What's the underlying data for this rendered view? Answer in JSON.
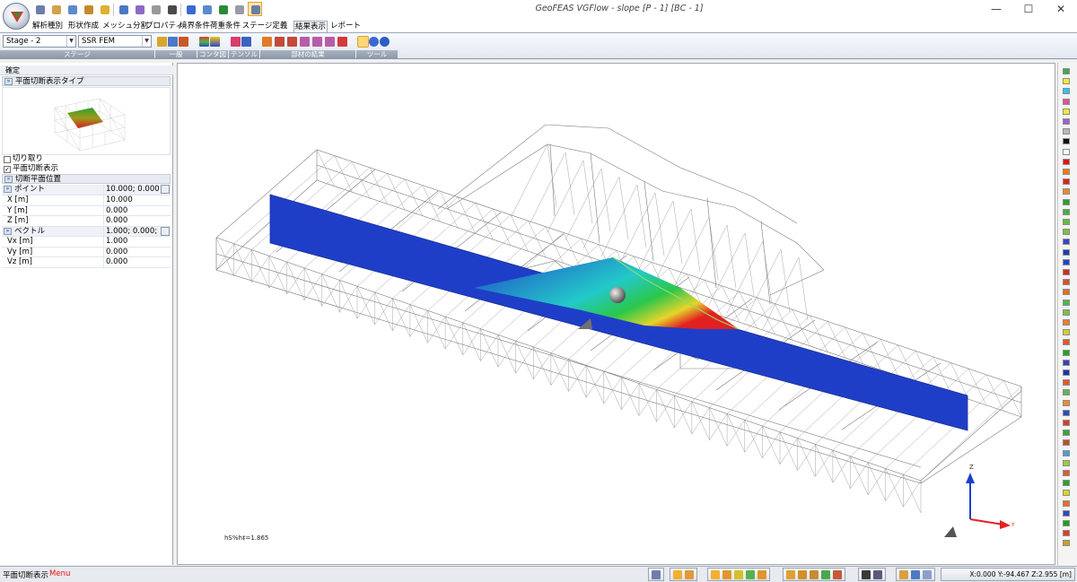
{
  "window": {
    "title": "GeoFEAS VGFlow - slope [P - 1] [BC - 1]",
    "controls": [
      "—",
      "☐",
      "✕"
    ]
  },
  "ribbon": {
    "tabs": [
      "解析種別",
      "形状作成",
      "メッシュ分割",
      "プロパティ",
      "境界条件",
      "荷重条件",
      "ステージ定義",
      "結果表示",
      "レポート"
    ],
    "active_tab": "結果表示",
    "stage_combo": "Stage - 2",
    "analysis_combo": "SSR FEM",
    "groups": [
      "ステージ",
      "一般",
      "コンタ図",
      "テンソル",
      "部材の結果",
      "ツール"
    ]
  },
  "left_panel": {
    "header": "確定",
    "section_title": "平面切断表示タイプ",
    "checkboxes": [
      {
        "label": "切り取り",
        "checked": false
      },
      {
        "label": "平面切断表示",
        "checked": true
      }
    ],
    "cut_position_title": "切断平面位置",
    "point": {
      "label": "ポイント",
      "value": "10.000; 0.000; 0"
    },
    "point_rows": [
      {
        "label": "X  [m]",
        "value": "10.000"
      },
      {
        "label": "Y  [m]",
        "value": "0.000"
      },
      {
        "label": "Z  [m]",
        "value": "0.000"
      }
    ],
    "vector": {
      "label": "ベクトル",
      "value": "1.000; 0.000; 0."
    },
    "vector_rows": [
      {
        "label": "Vx  [m]",
        "value": "1.000"
      },
      {
        "label": "Vy  [m]",
        "value": "0.000"
      },
      {
        "label": "Vz  [m]",
        "value": "0.000"
      }
    ]
  },
  "viewport": {
    "factor_label": "hS%h‡=1.865",
    "axis_labels": {
      "z": "Z",
      "y": "Y"
    }
  },
  "palette_colors": [
    "#4aa64a",
    "#f0ec2a",
    "#35c1ec",
    "#e44d9a",
    "#f0ec2a",
    "#9c62c9",
    "#b8b8b8",
    "#111111",
    "#ffffff",
    "#e81010",
    "#f07a18",
    "#e02020",
    "#e98a2b",
    "#2ca02c",
    "#42b142",
    "#5cbf3a",
    "#7ac142",
    "#3a46c4",
    "#1e3bb5",
    "#1f45c8",
    "#d62828",
    "#e84a2a",
    "#e07020",
    "#4ab84a",
    "#79c04a",
    "#ec7c2c",
    "#d0d033",
    "#e6552a",
    "#23a523",
    "#3a3fc0",
    "#1b34aa",
    "#e4592c",
    "#58b858",
    "#f08c2c",
    "#2c4bc4",
    "#d93d2a",
    "#35a635",
    "#c54a2a",
    "#4a9cdc",
    "#9ccc3a",
    "#e25a2a",
    "#2aa12a",
    "#d6d629",
    "#f06a22",
    "#3148bc",
    "#1aa31a",
    "#e53a2a",
    "#c4a22a"
  ],
  "status": {
    "text": "平面切断表示",
    "menu": "Menu",
    "coords": "X:0.000 Y:-94.467 Z:2.955 [m]"
  }
}
